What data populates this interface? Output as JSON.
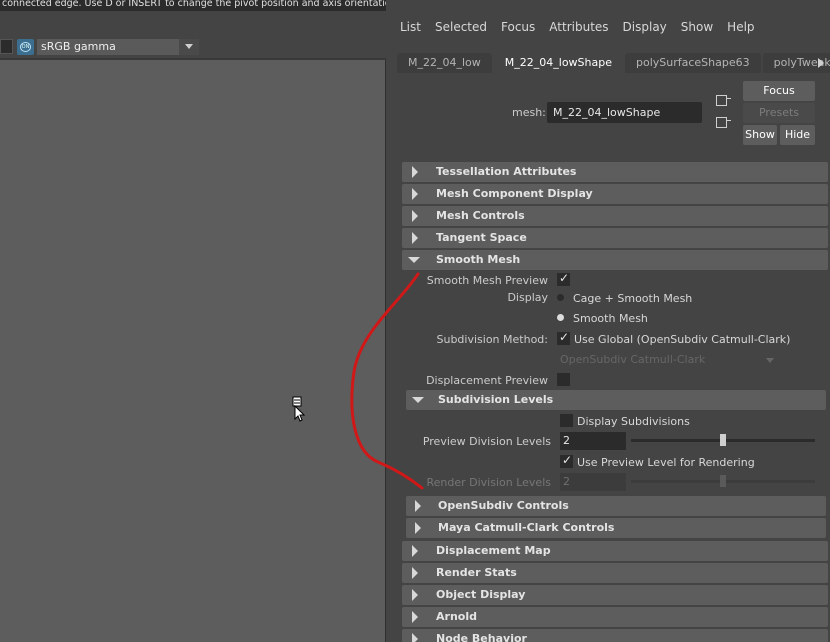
{
  "status_bar": {
    "text": "connected edge. Use D or INSERT to change the pivot position and axis orientation."
  },
  "viewport": {
    "colorspace_value": "sRGB gamma",
    "colorspace_icon": "colorspace-icon",
    "cursor_icon": "select-cursor-icon"
  },
  "attribute_editor": {
    "menu": [
      "List",
      "Selected",
      "Focus",
      "Attributes",
      "Display",
      "Show",
      "Help"
    ],
    "tabs": [
      {
        "label": "M_22_04_low",
        "active": false
      },
      {
        "label": "M_22_04_lowShape",
        "active": true
      },
      {
        "label": "polySurfaceShape63",
        "active": false
      },
      {
        "label": "polyTweakU",
        "active": false
      }
    ],
    "mesh_label": "mesh:",
    "mesh_value": "M_22_04_lowShape",
    "buttons": {
      "focus": "Focus",
      "presets": "Presets",
      "show": "Show",
      "hide": "Hide"
    },
    "frames_top": [
      "Tessellation Attributes",
      "Mesh Component Display",
      "Mesh Controls",
      "Tangent Space"
    ],
    "smooth_mesh": {
      "title": "Smooth Mesh",
      "preview_label": "Smooth Mesh Preview",
      "preview_checked": true,
      "display_label": "Display",
      "display_options": [
        "Cage + Smooth Mesh",
        "Smooth Mesh"
      ],
      "display_selected": "Smooth Mesh",
      "subdiv_method_label": "Subdivision Method:",
      "use_global_label": "Use Global (OpenSubdiv Catmull-Clark)",
      "use_global_checked": true,
      "subdiv_select_value": "OpenSubdiv Catmull-Clark",
      "displacement_preview_label": "Displacement Preview",
      "displacement_preview_checked": false,
      "subdivision_levels": {
        "title": "Subdivision Levels",
        "display_subdivisions_label": "Display Subdivisions",
        "display_subdivisions_checked": false,
        "preview_levels_label": "Preview Division Levels",
        "preview_levels_value": "2",
        "preview_levels_slider_fraction": 0.5,
        "use_preview_label": "Use Preview Level for Rendering",
        "use_preview_checked": true,
        "render_levels_label": "Render Division Levels",
        "render_levels_value": "2",
        "render_levels_slider_fraction": 0.5
      },
      "sub_frames": [
        "OpenSubdiv Controls",
        "Maya Catmull-Clark Controls"
      ]
    },
    "frames_bottom": [
      "Displacement Map",
      "Render Stats",
      "Object Display",
      "Arnold",
      "Node Behavior"
    ]
  },
  "colors": {
    "annotation_stroke": "#d01818",
    "frame_header": "#5d5d5d",
    "field_bg": "#2b2b2b",
    "panel_bg": "#444444",
    "viewport_bg": "#5d5d5d"
  }
}
